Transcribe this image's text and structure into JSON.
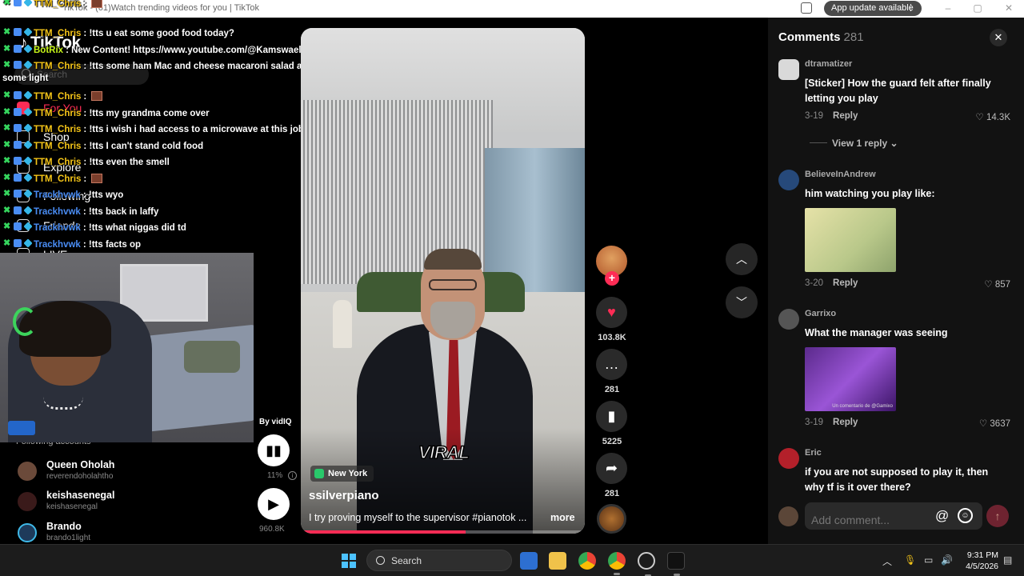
{
  "browser": {
    "tab_title": "TikTok - (61)Watch trending videos for you | TikTok",
    "update_pill": "App update available",
    "update_menu": "⋮"
  },
  "sidebar": {
    "logo": "TikTok",
    "search_placeholder": "Search",
    "nav_items": [
      {
        "label": "For You",
        "icon": "home-icon"
      },
      {
        "label": "Shop",
        "icon": "shop-icon"
      },
      {
        "label": "Explore",
        "icon": "explore-icon"
      },
      {
        "label": "Following",
        "icon": "following-icon"
      },
      {
        "label": "Friends",
        "icon": "friends-icon"
      },
      {
        "label": "LIVE",
        "icon": "live-icon"
      }
    ],
    "following_header": "Following accounts",
    "accounts": [
      {
        "name": "Queen Oholah",
        "handle": "reverendoholahtho"
      },
      {
        "name": "keishasenegal",
        "handle": "keishasenegal"
      },
      {
        "name": "Brando",
        "handle": "brando1light"
      }
    ]
  },
  "chat": {
    "lines": [
      {
        "user": "TTM_Chris",
        "message": "",
        "emote": true,
        "color": "#f5c518"
      },
      {
        "user": "TTM_Chris",
        "message": "!tts u eat some good food today?",
        "emote": false,
        "color": "#f5c518"
      },
      {
        "user": "BotRix",
        "message": "New Content! https://www.youtube.com/@Kamswaelive",
        "emote": false,
        "color": "#c7f518"
      },
      {
        "user": "TTM_Chris",
        "message": "!tts some ham Mac and cheese macaroni salad and rice",
        "emote": false,
        "color": "#f5c518"
      },
      {
        "user": "TTM_Chris",
        "message": "",
        "emote": true,
        "color": "#f5c518"
      },
      {
        "user": "TTM_Chris",
        "message": "!tts my grandma come over",
        "emote": false,
        "color": "#f5c518"
      },
      {
        "user": "TTM_Chris",
        "message": "!tts i wish i had access to a microwave at this job",
        "emote": false,
        "color": "#f5c518"
      },
      {
        "user": "TTM_Chris",
        "message": "!tts I can't stand cold food",
        "emote": false,
        "color": "#f5c518"
      },
      {
        "user": "TTM_Chris",
        "message": "!tts even the smell",
        "emote": false,
        "color": "#f5c518"
      },
      {
        "user": "TTM_Chris",
        "message": "",
        "emote": true,
        "color": "#f5c518"
      },
      {
        "user": "Trackhvwk",
        "message": "!tts wyo",
        "emote": false,
        "color": "#4a8df5"
      },
      {
        "user": "Trackhvwk",
        "message": "!tts back in laffy",
        "emote": false,
        "color": "#4a8df5"
      },
      {
        "user": "Trackhvwk",
        "message": "!tts what niggas did td",
        "emote": false,
        "color": "#4a8df5"
      },
      {
        "user": "Trackhvwk",
        "message": "!tts facts op",
        "emote": false,
        "color": "#4a8df5"
      }
    ],
    "wrapped_text": "some light"
  },
  "player": {
    "by_line": "By vidIQ",
    "volume_pct": "11%",
    "plays": "960.8K",
    "overlay_text": "VIRAL",
    "location": "New York",
    "author": "ssilverpiano",
    "caption": "I try proving myself to the supervisor #pianotok ...",
    "more": "more",
    "progress": 0.58
  },
  "actions": {
    "likes": "103.8K",
    "comments": "281",
    "saves": "5225",
    "shares": "281"
  },
  "comments": {
    "title": "Comments",
    "count": "281",
    "reply_label": "Reply",
    "view_replies": "View 1 reply",
    "input_placeholder": "Add comment...",
    "items": [
      {
        "user": "dtramatizer",
        "text": "[Sticker] How the guard felt after finally letting you play",
        "date": "3-19",
        "likes": "14.3K"
      },
      {
        "user": "BelieveInAndrew",
        "text": "him watching you play like:",
        "date": "3-20",
        "likes": "857"
      },
      {
        "user": "Garrixo",
        "text": "What the manager was seeing",
        "date": "3-19",
        "likes": "3637"
      },
      {
        "user": "Eric",
        "text": "if you are not supposed to play it, then why tf is it over there?",
        "date": "",
        "likes": ""
      }
    ],
    "sticker_caption": "Un comentario de @Gamixo"
  },
  "taskbar": {
    "search_label": "Search",
    "time": "9:31 PM",
    "date": "4/5/2026"
  },
  "colors": {
    "accent": "#fe2c55",
    "comments_bg": "#121212"
  }
}
